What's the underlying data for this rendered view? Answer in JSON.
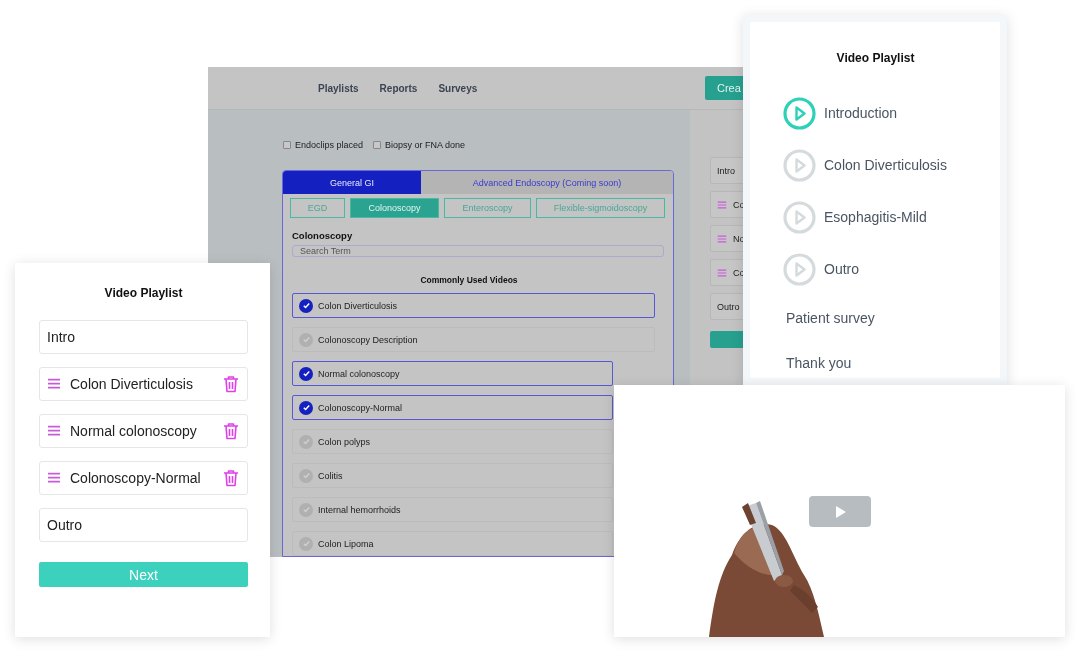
{
  "background_app": {
    "nav": [
      "Playlists",
      "Reports",
      "Surveys"
    ],
    "create_button": "Crea",
    "checkboxes": [
      {
        "label": "Endoclips placed",
        "checked": false
      },
      {
        "label": "Biopsy or FNA done",
        "checked": false
      }
    ],
    "tabs": [
      {
        "label": "General GI",
        "selected": true
      },
      {
        "label": "Advanced Endoscopy (Coming soon)",
        "selected": false
      }
    ],
    "subtabs": [
      {
        "label": "EGD",
        "selected": false
      },
      {
        "label": "Colonoscopy",
        "selected": true
      },
      {
        "label": "Enteroscopy",
        "selected": false
      },
      {
        "label": "Flexible-sigmoidoscopy",
        "selected": false
      }
    ],
    "section_title": "Colonoscopy",
    "search": {
      "placeholder": "Search Term"
    },
    "list_title": "Commonly Used Videos",
    "videos": [
      {
        "name": "Colon Diverticulosis",
        "checked": true
      },
      {
        "name": "Colonoscopy Description",
        "checked": false
      },
      {
        "name": "Normal colonoscopy",
        "checked": true
      },
      {
        "name": "Colonoscopy-Normal",
        "checked": true
      },
      {
        "name": "Colon polyps",
        "checked": false
      },
      {
        "name": "Colitis",
        "checked": false
      },
      {
        "name": "Internal hemorrhoids",
        "checked": false
      },
      {
        "name": "Colon Lipoma",
        "checked": false
      }
    ],
    "side_playlist": [
      {
        "label": "Intro",
        "kind": "fixed"
      },
      {
        "label": "Co",
        "kind": "video"
      },
      {
        "label": "No",
        "kind": "video"
      },
      {
        "label": "Co",
        "kind": "video"
      },
      {
        "label": "Outro",
        "kind": "fixed"
      }
    ]
  },
  "playlist_editor": {
    "title": "Video Playlist",
    "items": [
      {
        "label": "Intro",
        "kind": "fixed"
      },
      {
        "label": "Colon Diverticulosis",
        "kind": "video"
      },
      {
        "label": "Normal colonoscopy",
        "kind": "video"
      },
      {
        "label": "Colonoscopy-Normal",
        "kind": "video"
      },
      {
        "label": "Outro",
        "kind": "fixed"
      }
    ],
    "next_button": "Next"
  },
  "playlist_viewer": {
    "title": "Video Playlist",
    "items": [
      {
        "label": "Introduction",
        "kind": "video",
        "selected": true
      },
      {
        "label": "Colon Diverticulosis",
        "kind": "video",
        "selected": false
      },
      {
        "label": "Esophagitis-Mild",
        "kind": "video",
        "selected": false
      },
      {
        "label": "Outro",
        "kind": "video",
        "selected": false
      },
      {
        "label": "Patient survey",
        "kind": "step"
      },
      {
        "label": "Thank you",
        "kind": "step"
      }
    ]
  }
}
